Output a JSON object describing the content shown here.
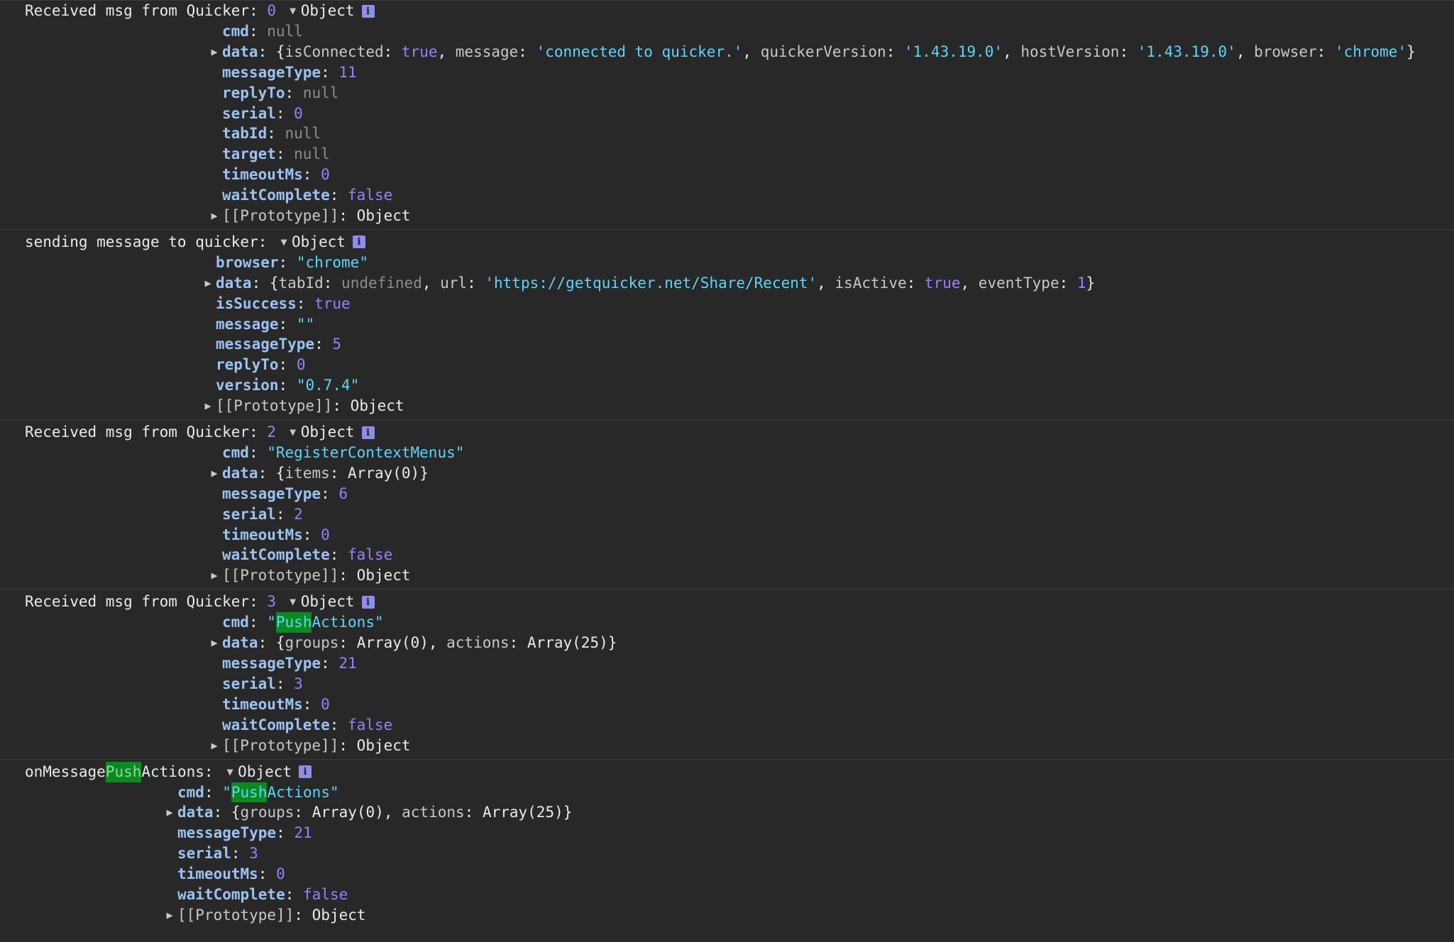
{
  "colors": {
    "background": "#282828",
    "property_key": "#9cc2f3",
    "number_bool": "#9980ff",
    "string": "#5cd5fb",
    "null": "#8d8d8d",
    "search_highlight": "#0b8a1f",
    "info_badge": "#8e8eea"
  },
  "icons": {
    "expanded": "triangle-down-icon",
    "collapsed": "triangle-right-icon",
    "info": "info-icon"
  },
  "glyphs": {
    "expanded": "▼",
    "collapsed": "▶",
    "info": "i",
    "object_label": "Object",
    "prototype_key": "[[Prototype]]",
    "prototype_value": "Object"
  },
  "messages": [
    {
      "prefix": "Received msg from Quicker: ",
      "prefix_number": "0",
      "rows": [
        {
          "key": "cmd",
          "value": "null",
          "type": "null"
        },
        {
          "key": "data",
          "expandable": true,
          "preview": [
            {
              "t": "punc",
              "s": "{"
            },
            {
              "t": "kp",
              "s": "isConnected"
            },
            {
              "t": "punc",
              "s": ": "
            },
            {
              "t": "bool",
              "s": "true"
            },
            {
              "t": "punc",
              "s": ", "
            },
            {
              "t": "kp",
              "s": "message"
            },
            {
              "t": "punc",
              "s": ": "
            },
            {
              "t": "str",
              "s": "'connected to quicker.'"
            },
            {
              "t": "punc",
              "s": ", "
            },
            {
              "t": "kp",
              "s": "quickerVersion"
            },
            {
              "t": "punc",
              "s": ": "
            },
            {
              "t": "str",
              "s": "'1.43.19.0'"
            },
            {
              "t": "punc",
              "s": ", "
            },
            {
              "t": "kp",
              "s": "hostVersion"
            },
            {
              "t": "punc",
              "s": ": "
            },
            {
              "t": "str",
              "s": "'1.43.19.0'"
            },
            {
              "t": "punc",
              "s": ", "
            },
            {
              "t": "kp",
              "s": "browser"
            },
            {
              "t": "punc",
              "s": ": "
            },
            {
              "t": "str",
              "s": "'chrome'"
            },
            {
              "t": "punc",
              "s": "}"
            }
          ]
        },
        {
          "key": "messageType",
          "value": "11",
          "type": "num"
        },
        {
          "key": "replyTo",
          "value": "null",
          "type": "null"
        },
        {
          "key": "serial",
          "value": "0",
          "type": "num"
        },
        {
          "key": "tabId",
          "value": "null",
          "type": "null"
        },
        {
          "key": "target",
          "value": "null",
          "type": "null"
        },
        {
          "key": "timeoutMs",
          "value": "0",
          "type": "num"
        },
        {
          "key": "waitComplete",
          "value": "false",
          "type": "bool"
        },
        {
          "key": "[[Prototype]]",
          "value": "Object",
          "type": "proto",
          "expandable": true
        }
      ]
    },
    {
      "prefix": "sending message to quicker: ",
      "prefix_number": "",
      "rows": [
        {
          "key": "browser",
          "value": "\"chrome\"",
          "type": "str"
        },
        {
          "key": "data",
          "expandable": true,
          "preview": [
            {
              "t": "punc",
              "s": "{"
            },
            {
              "t": "kp",
              "s": "tabId"
            },
            {
              "t": "punc",
              "s": ": "
            },
            {
              "t": "null",
              "s": "undefined"
            },
            {
              "t": "punc",
              "s": ", "
            },
            {
              "t": "kp",
              "s": "url"
            },
            {
              "t": "punc",
              "s": ": "
            },
            {
              "t": "str",
              "s": "'https://getquicker.net/Share/Recent'"
            },
            {
              "t": "punc",
              "s": ", "
            },
            {
              "t": "kp",
              "s": "isActive"
            },
            {
              "t": "punc",
              "s": ": "
            },
            {
              "t": "bool",
              "s": "true"
            },
            {
              "t": "punc",
              "s": ", "
            },
            {
              "t": "kp",
              "s": "eventType"
            },
            {
              "t": "punc",
              "s": ": "
            },
            {
              "t": "num",
              "s": "1"
            },
            {
              "t": "punc",
              "s": "}"
            }
          ]
        },
        {
          "key": "isSuccess",
          "value": "true",
          "type": "bool"
        },
        {
          "key": "message",
          "value": "\"\"",
          "type": "str"
        },
        {
          "key": "messageType",
          "value": "5",
          "type": "num"
        },
        {
          "key": "replyTo",
          "value": "0",
          "type": "num"
        },
        {
          "key": "version",
          "value": "\"0.7.4\"",
          "type": "str"
        },
        {
          "key": "[[Prototype]]",
          "value": "Object",
          "type": "proto",
          "expandable": true
        }
      ]
    },
    {
      "prefix": "Received msg from Quicker: ",
      "prefix_number": "2",
      "rows": [
        {
          "key": "cmd",
          "value": "\"RegisterContextMenus\"",
          "type": "str"
        },
        {
          "key": "data",
          "expandable": true,
          "preview": [
            {
              "t": "punc",
              "s": "{"
            },
            {
              "t": "kp",
              "s": "items"
            },
            {
              "t": "punc",
              "s": ": "
            },
            {
              "t": "obj",
              "s": "Array(0)"
            },
            {
              "t": "punc",
              "s": "}"
            }
          ]
        },
        {
          "key": "messageType",
          "value": "6",
          "type": "num"
        },
        {
          "key": "serial",
          "value": "2",
          "type": "num"
        },
        {
          "key": "timeoutMs",
          "value": "0",
          "type": "num"
        },
        {
          "key": "waitComplete",
          "value": "false",
          "type": "bool"
        },
        {
          "key": "[[Prototype]]",
          "value": "Object",
          "type": "proto",
          "expandable": true
        }
      ]
    },
    {
      "prefix": "Received msg from Quicker: ",
      "prefix_number": "3",
      "rows": [
        {
          "key": "cmd",
          "type": "rich",
          "parts": [
            {
              "t": "str",
              "s": "\""
            },
            {
              "t": "hl",
              "s": "Push"
            },
            {
              "t": "str",
              "s": "Actions\""
            }
          ]
        },
        {
          "key": "data",
          "expandable": true,
          "preview": [
            {
              "t": "punc",
              "s": "{"
            },
            {
              "t": "kp",
              "s": "groups"
            },
            {
              "t": "punc",
              "s": ": "
            },
            {
              "t": "obj",
              "s": "Array(0)"
            },
            {
              "t": "punc",
              "s": ", "
            },
            {
              "t": "kp",
              "s": "actions"
            },
            {
              "t": "punc",
              "s": ": "
            },
            {
              "t": "obj",
              "s": "Array(25)"
            },
            {
              "t": "punc",
              "s": "}"
            }
          ]
        },
        {
          "key": "messageType",
          "value": "21",
          "type": "num"
        },
        {
          "key": "serial",
          "value": "3",
          "type": "num"
        },
        {
          "key": "timeoutMs",
          "value": "0",
          "type": "num"
        },
        {
          "key": "waitComplete",
          "value": "false",
          "type": "bool"
        },
        {
          "key": "[[Prototype]]",
          "value": "Object",
          "type": "proto",
          "expandable": true
        }
      ]
    },
    {
      "prefix_parts": [
        {
          "t": "punc",
          "s": "onMessage"
        },
        {
          "t": "hlp",
          "s": "Push"
        },
        {
          "t": "punc",
          "s": "Actions: "
        }
      ],
      "prefix_number": "",
      "rows": [
        {
          "key": "cmd",
          "type": "rich",
          "parts": [
            {
              "t": "str",
              "s": "\""
            },
            {
              "t": "hl",
              "s": "Push"
            },
            {
              "t": "str",
              "s": "Actions\""
            }
          ]
        },
        {
          "key": "data",
          "expandable": true,
          "preview": [
            {
              "t": "punc",
              "s": "{"
            },
            {
              "t": "kp",
              "s": "groups"
            },
            {
              "t": "punc",
              "s": ": "
            },
            {
              "t": "obj",
              "s": "Array(0)"
            },
            {
              "t": "punc",
              "s": ", "
            },
            {
              "t": "kp",
              "s": "actions"
            },
            {
              "t": "punc",
              "s": ": "
            },
            {
              "t": "obj",
              "s": "Array(25)"
            },
            {
              "t": "punc",
              "s": "}"
            }
          ]
        },
        {
          "key": "messageType",
          "value": "21",
          "type": "num"
        },
        {
          "key": "serial",
          "value": "3",
          "type": "num"
        },
        {
          "key": "timeoutMs",
          "value": "0",
          "type": "num"
        },
        {
          "key": "waitComplete",
          "value": "false",
          "type": "bool"
        },
        {
          "key": "[[Prototype]]",
          "value": "Object",
          "type": "proto",
          "expandable": true
        }
      ]
    }
  ]
}
